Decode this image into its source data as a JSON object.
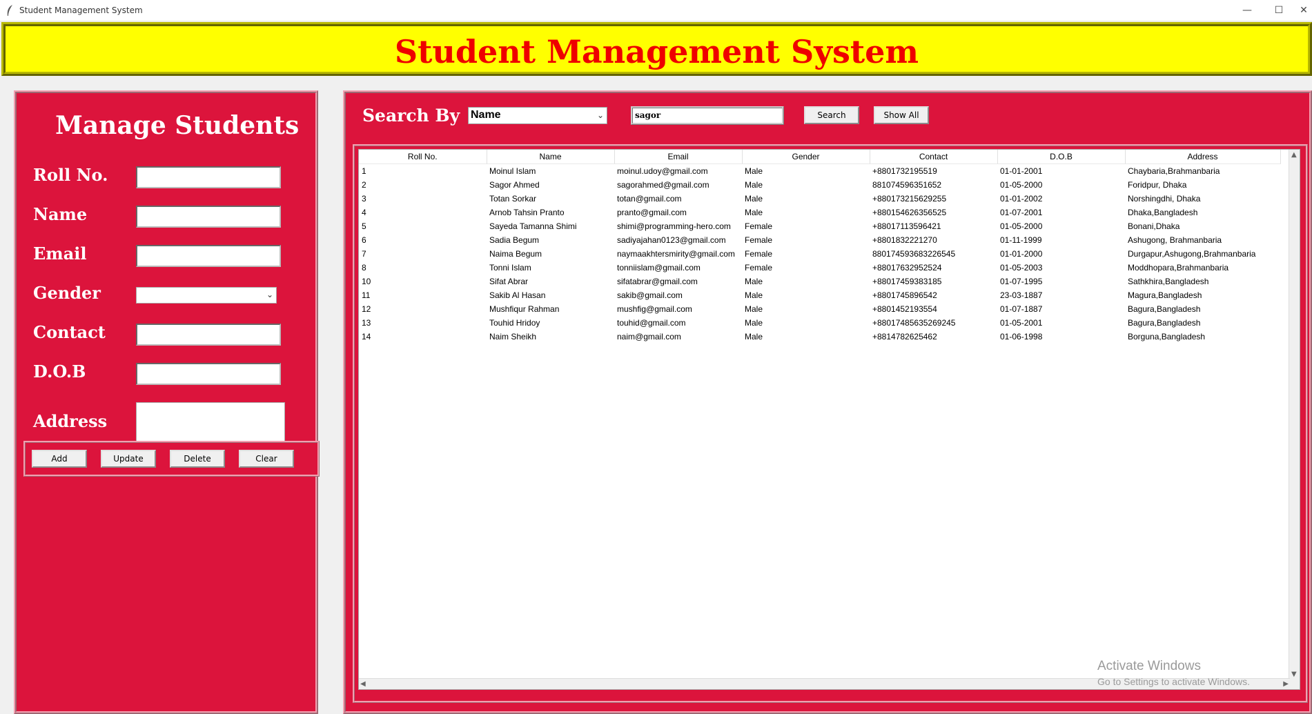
{
  "window": {
    "title": "Student Management System",
    "minimize": "—",
    "maximize": "☐",
    "close": "✕"
  },
  "header": {
    "title": "Student Management System"
  },
  "manage": {
    "title": "Manage Students",
    "fields": {
      "roll": {
        "label": "Roll No.",
        "value": ""
      },
      "name": {
        "label": "Name",
        "value": ""
      },
      "email": {
        "label": "Email",
        "value": ""
      },
      "gender": {
        "label": "Gender",
        "value": ""
      },
      "contact": {
        "label": "Contact",
        "value": ""
      },
      "dob": {
        "label": "D.O.B",
        "value": ""
      },
      "address": {
        "label": "Address",
        "value": ""
      }
    },
    "buttons": {
      "add": "Add",
      "update": "Update",
      "delete": "Delete",
      "clear": "Clear"
    }
  },
  "search": {
    "label": "Search By",
    "by_selected": "Name",
    "query": "sagor",
    "search_button": "Search",
    "show_all_button": "Show All"
  },
  "table": {
    "columns": [
      "Roll No.",
      "Name",
      "Email",
      "Gender",
      "Contact",
      "D.O.B",
      "Address"
    ],
    "rows": [
      [
        "1",
        "Moinul Islam",
        "moinul.udoy@gmail.com",
        "Male",
        "+8801732195519",
        "01-01-2001",
        "Chaybaria,Brahmanbaria"
      ],
      [
        "2",
        "Sagor Ahmed",
        "sagorahmed@gmail.com",
        "Male",
        "881074596351652",
        "01-05-2000",
        "Foridpur, Dhaka"
      ],
      [
        "3",
        "Totan Sorkar",
        "totan@gmail.com",
        "Male",
        "+880173215629255",
        "01-01-2002",
        "Norshingdhi, Dhaka"
      ],
      [
        "4",
        "Arnob Tahsin Pranto",
        "pranto@gmail.com",
        "Male",
        "+880154626356525",
        "01-07-2001",
        "Dhaka,Bangladesh"
      ],
      [
        "5",
        "Sayeda Tamanna Shimi",
        "shimi@programming-hero.com",
        "Female",
        "+88017113596421",
        "01-05-2000",
        "Bonani,Dhaka"
      ],
      [
        "6",
        "Sadia Begum",
        "sadiyajahan0123@gmail.com",
        "Female",
        "+8801832221270",
        "01-11-1999",
        "Ashugong, Brahmanbaria"
      ],
      [
        "7",
        "Naima Begum",
        "naymaakhtersmirity@gmail.com",
        "Female",
        "880174593683226545",
        "01-01-2000",
        "Durgapur,Ashugong,Brahmanbaria"
      ],
      [
        "8",
        "Tonni Islam",
        "tonniislam@gmail.com",
        "Female",
        "+88017632952524",
        "01-05-2003",
        "Moddhopara,Brahmanbaria"
      ],
      [
        "10",
        "Sifat Abrar",
        "sifatabrar@gmail.com",
        "Male",
        "+88017459383185",
        "01-07-1995",
        "Sathkhira,Bangladesh"
      ],
      [
        "11",
        "Sakib Al Hasan",
        "sakib@gmail.com",
        "Male",
        "+8801745896542",
        "23-03-1887",
        "Magura,Bangladesh"
      ],
      [
        "12",
        "Mushfiqur Rahman",
        "mushfig@gmail.com",
        "Male",
        "+8801452193554",
        "01-07-1887",
        "Bagura,Bangladesh"
      ],
      [
        "13",
        "Touhid Hridoy",
        "touhid@gmail.com",
        "Male",
        "+88017485635269245",
        "01-05-2001",
        "Bagura,Bangladesh"
      ],
      [
        "14",
        "Naim Sheikh",
        "naim@gmail.com",
        "Male",
        "+8814782625462",
        "01-06-1998",
        "Borguna,Bangladesh"
      ]
    ]
  },
  "watermark": {
    "line1": "Activate Windows",
    "line2": "Go to Settings to activate Windows."
  },
  "colors": {
    "panel": "#dc143c",
    "header_bg": "#ffff00",
    "header_text": "#ee0000"
  }
}
